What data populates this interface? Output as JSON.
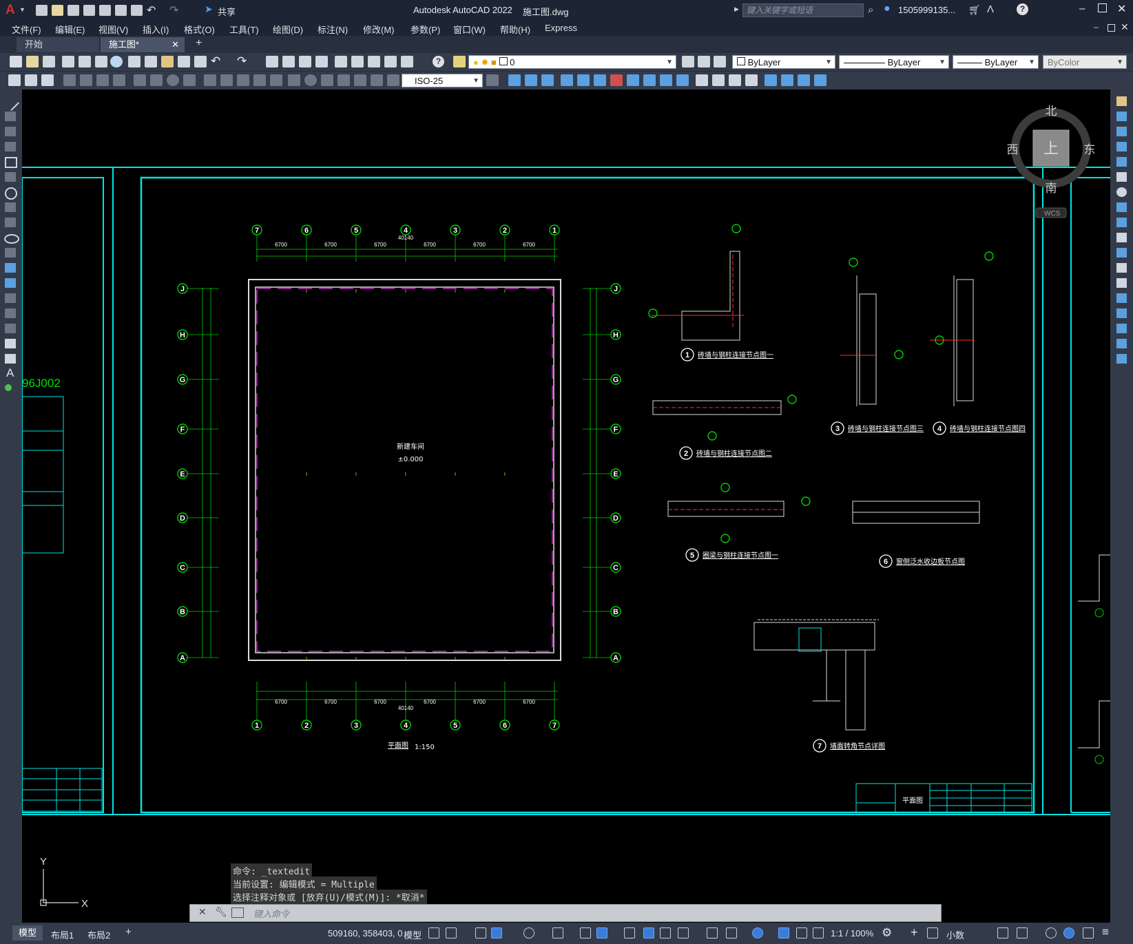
{
  "app": {
    "logo": "A",
    "title": "Autodesk AutoCAD 2022",
    "filename": "施工图.dwg",
    "share_label": "共享",
    "search_placeholder": "键入关键字或短语",
    "user": "1505999135...",
    "accent_red": "#d0312d",
    "cad_cyan": "#00e5e5",
    "cad_green": "#00d000"
  },
  "menu": {
    "items": [
      "文件(F)",
      "编辑(E)",
      "视图(V)",
      "插入(I)",
      "格式(O)",
      "工具(T)",
      "绘图(D)",
      "标注(N)",
      "修改(M)",
      "参数(P)",
      "窗口(W)",
      "帮助(H)",
      "Express"
    ]
  },
  "tabs": {
    "start": "开始",
    "drawing": "施工图*",
    "new": "+"
  },
  "toolbar": {
    "layer": "0",
    "color": "ByLayer",
    "linetype": "ByLayer",
    "lineweight": "ByLayer",
    "plotstyle": "ByColor",
    "dimstyle": "ISO-25"
  },
  "viewcube": {
    "north": "北",
    "south": "南",
    "east": "东",
    "west": "西",
    "face": "上",
    "wcs": "WCS"
  },
  "drawing": {
    "left_code": "96J002",
    "grid_numbers": [
      "7",
      "6",
      "5",
      "4",
      "3",
      "2",
      "1"
    ],
    "grid_letters": [
      "J",
      "H",
      "G",
      "F",
      "E",
      "D",
      "C",
      "B",
      "A"
    ],
    "bottom_numbers": [
      "1",
      "2",
      "3",
      "4",
      "5",
      "6",
      "7"
    ],
    "dim_total": "40140",
    "dim_bay": "6700",
    "room_name": "新建车间",
    "room_elev": "±0.000",
    "plan_title": "平面图",
    "plan_scale": "1:150",
    "details": [
      {
        "num": "1",
        "label": "砖墙与钢柱连接节点图一"
      },
      {
        "num": "2",
        "label": "砖墙与钢柱连接节点图二"
      },
      {
        "num": "3",
        "label": "砖墙与钢柱连接节点图三"
      },
      {
        "num": "4",
        "label": "砖墙与钢柱连接节点图四"
      },
      {
        "num": "5",
        "label": "圈梁与钢柱连接节点图一"
      },
      {
        "num": "6",
        "label": "窗侧泛水收边板节点图"
      },
      {
        "num": "7",
        "label": "墙面转角节点详图"
      }
    ],
    "titleblock_name": "平面图",
    "ucs_x": "X",
    "ucs_y": "Y"
  },
  "command": {
    "history": [
      "命令: _textedit",
      "当前设置: 编辑模式 = Multiple",
      "选择注释对象或 [放弃(U)/模式(M)]: *取消*"
    ],
    "input_placeholder": "键入命令"
  },
  "layout_tabs": [
    "模型",
    "布局1",
    "布局2"
  ],
  "status": {
    "coords": "509160, 358403, 0",
    "space": "模型",
    "scale": "1:1 / 100%",
    "units": "小数"
  }
}
